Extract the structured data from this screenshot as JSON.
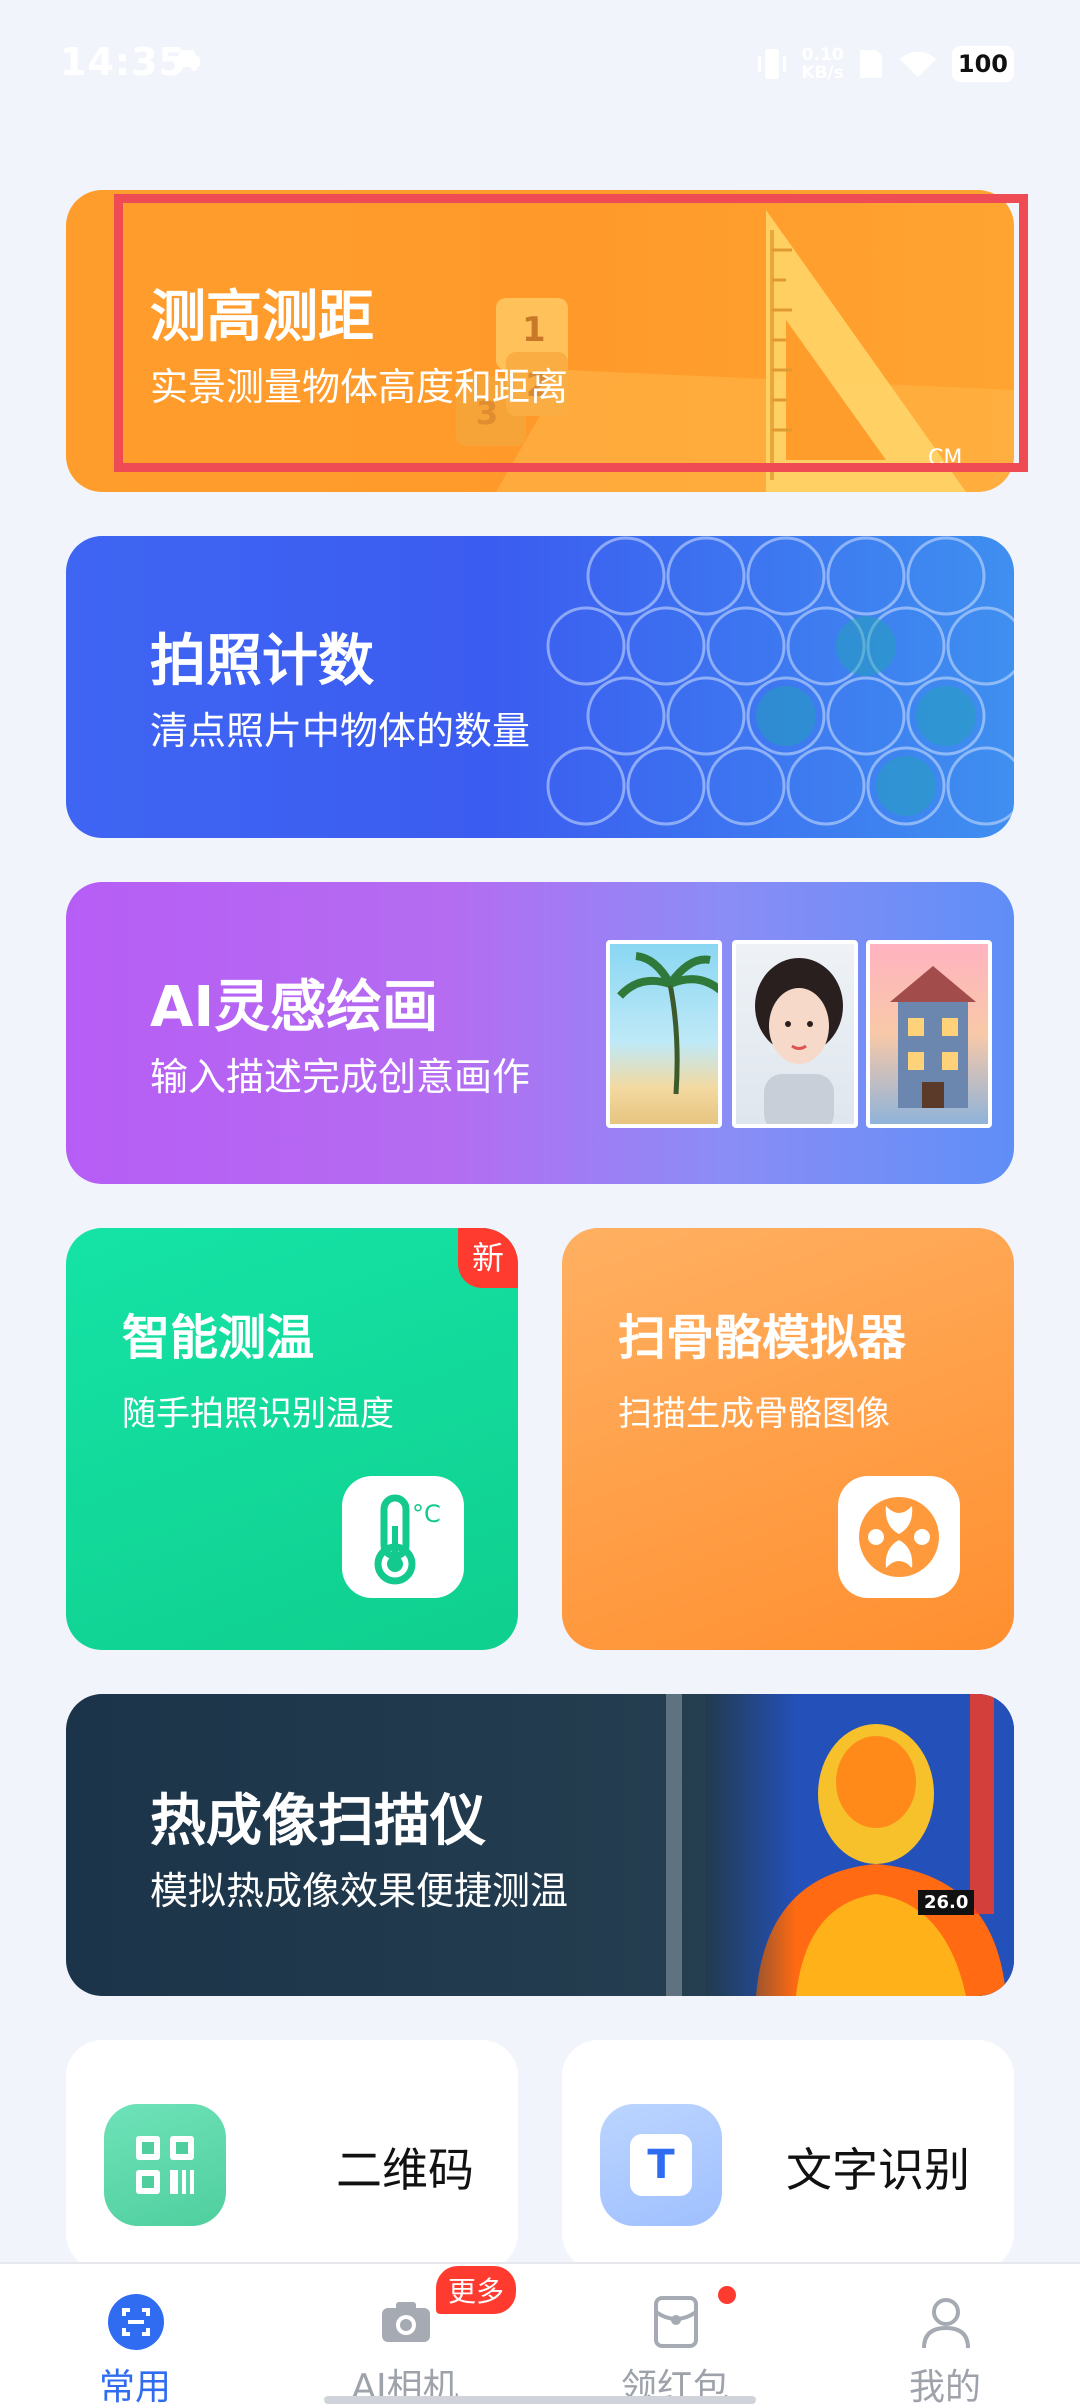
{
  "status_bar": {
    "time": "14:35",
    "speed_top": "0.10",
    "speed_bottom": "KB/s",
    "battery": "100"
  },
  "cards": {
    "measure": {
      "title": "测高测距",
      "subtitle": "实景测量物体高度和距离",
      "ruler_numbers": [
        "1",
        "2",
        "3"
      ],
      "unit": "CM"
    },
    "count": {
      "title": "拍照计数",
      "subtitle": "清点照片中物体的数量"
    },
    "ai_paint": {
      "title": "AI灵感绘画",
      "subtitle": "输入描述完成创意画作"
    },
    "temperature": {
      "title": "智能测温",
      "subtitle": "随手拍照识别温度",
      "badge": "新"
    },
    "bone": {
      "title": "扫骨骼模拟器",
      "subtitle": "扫描生成骨骼图像"
    },
    "thermal": {
      "title": "热成像扫描仪",
      "subtitle": "模拟热成像效果便捷测温",
      "reading": "26.0"
    }
  },
  "tools": {
    "qr": {
      "label": "二维码"
    },
    "ocr": {
      "label": "文字识别",
      "icon_letter": "T"
    }
  },
  "bottom_nav": {
    "items": [
      {
        "label": "常用",
        "active": true
      },
      {
        "label": "AI相机",
        "badge": "更多"
      },
      {
        "label": "领红包"
      },
      {
        "label": "我的"
      }
    ]
  },
  "colors": {
    "measure": "#ff9d2c",
    "count": "#3f65f3",
    "ai_paint": "#b65df5",
    "temperature": "#15e3a6",
    "bone": "#ff9a3c",
    "thermal": "#1c3449",
    "nav_active": "#2f6cf2",
    "highlight": "#ee4b55",
    "badge": "#ff3b30"
  }
}
